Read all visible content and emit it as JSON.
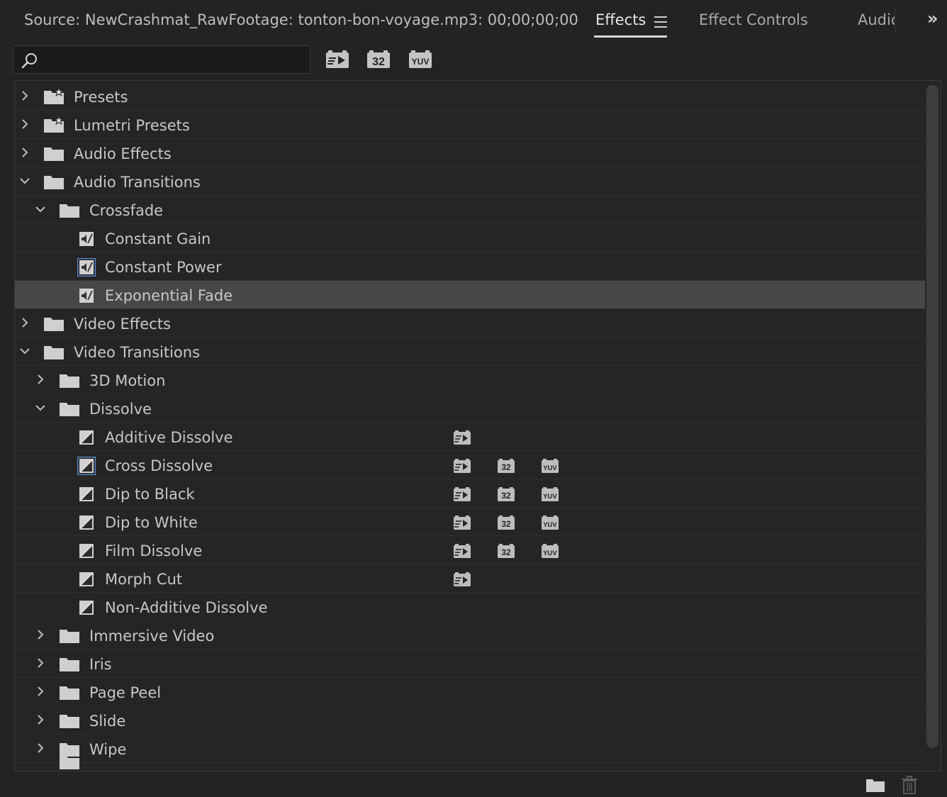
{
  "header": {
    "source_title": "Source: NewCrashmat_RawFootage: tonton-bon-voyage.mp3: 00;00;00;00",
    "tabs": [
      {
        "label": "Effects",
        "active": true
      },
      {
        "label": "Effect Controls",
        "active": false
      },
      {
        "label": "Audio",
        "active": false
      }
    ],
    "overflow_glyph": "»"
  },
  "search": {
    "value": "",
    "placeholder": ""
  },
  "filters": {
    "accelerated_icon": "accelerated-effects-icon",
    "bit32_label": "32",
    "yuv_label": "YUV"
  },
  "tree": {
    "rows": [
      {
        "label": "Presets",
        "kind": "preset-folder",
        "depth": 0,
        "expanded": false
      },
      {
        "label": "Lumetri Presets",
        "kind": "preset-folder",
        "depth": 0,
        "expanded": false
      },
      {
        "label": "Audio Effects",
        "kind": "folder",
        "depth": 0,
        "expanded": false
      },
      {
        "label": "Audio Transitions",
        "kind": "folder",
        "depth": 0,
        "expanded": true
      },
      {
        "label": "Crossfade",
        "kind": "folder",
        "depth": 1,
        "expanded": true
      },
      {
        "label": "Constant Gain",
        "kind": "audio-transition",
        "depth": 2
      },
      {
        "label": "Constant Power",
        "kind": "audio-transition",
        "depth": 2,
        "default": true
      },
      {
        "label": "Exponential Fade",
        "kind": "audio-transition",
        "depth": 2,
        "selected": true
      },
      {
        "label": "Video Effects",
        "kind": "folder",
        "depth": 0,
        "expanded": false
      },
      {
        "label": "Video Transitions",
        "kind": "folder",
        "depth": 0,
        "expanded": true
      },
      {
        "label": "3D Motion",
        "kind": "folder",
        "depth": 1,
        "expanded": false
      },
      {
        "label": "Dissolve",
        "kind": "folder",
        "depth": 1,
        "expanded": true
      },
      {
        "label": "Additive Dissolve",
        "kind": "video-transition",
        "depth": 2,
        "accelerated": true
      },
      {
        "label": "Cross Dissolve",
        "kind": "video-transition",
        "depth": 2,
        "default": true,
        "accelerated": true,
        "bit32": true,
        "yuv": true
      },
      {
        "label": "Dip to Black",
        "kind": "video-transition",
        "depth": 2,
        "accelerated": true,
        "bit32": true,
        "yuv": true
      },
      {
        "label": "Dip to White",
        "kind": "video-transition",
        "depth": 2,
        "accelerated": true,
        "bit32": true,
        "yuv": true
      },
      {
        "label": "Film Dissolve",
        "kind": "video-transition",
        "depth": 2,
        "accelerated": true,
        "bit32": true,
        "yuv": true
      },
      {
        "label": "Morph Cut",
        "kind": "video-transition",
        "depth": 2,
        "accelerated": true
      },
      {
        "label": "Non-Additive Dissolve",
        "kind": "video-transition",
        "depth": 2
      },
      {
        "label": "Immersive Video",
        "kind": "folder",
        "depth": 1,
        "expanded": false
      },
      {
        "label": "Iris",
        "kind": "folder",
        "depth": 1,
        "expanded": false
      },
      {
        "label": "Page Peel",
        "kind": "folder",
        "depth": 1,
        "expanded": false
      },
      {
        "label": "Slide",
        "kind": "folder",
        "depth": 1,
        "expanded": false
      },
      {
        "label": "Wipe",
        "kind": "folder",
        "depth": 1,
        "expanded": false
      },
      {
        "label": "",
        "kind": "folder",
        "depth": 1,
        "expanded": false,
        "partial": true
      }
    ]
  },
  "footer": {
    "new_bin_icon": "new-bin-icon",
    "delete_icon": "trash-icon"
  },
  "colors": {
    "background": "#232323",
    "panel": "#252525",
    "selected_row": "#474747",
    "default_highlight": "#5b8fd6",
    "text": "#c7c7c7"
  }
}
